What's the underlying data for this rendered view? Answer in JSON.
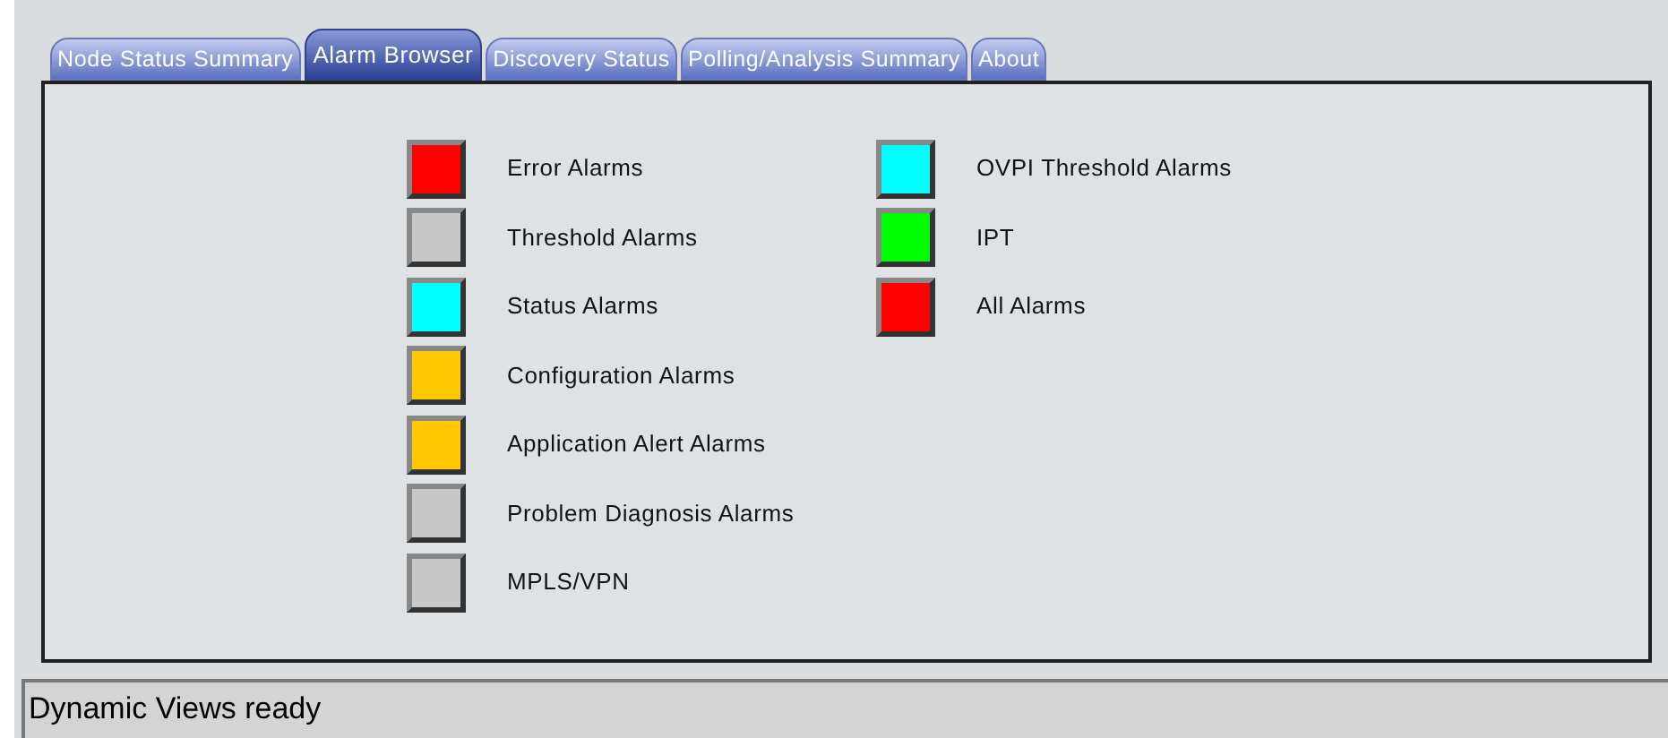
{
  "tabs": [
    {
      "label": "Node Status Summary",
      "selected": false
    },
    {
      "label": "Alarm Browser",
      "selected": true
    },
    {
      "label": "Discovery Status",
      "selected": false
    },
    {
      "label": "Polling/Analysis Summary",
      "selected": false
    },
    {
      "label": "About",
      "selected": false
    }
  ],
  "alarm_columns": [
    [
      {
        "label": "Error Alarms",
        "color": "#ff0000"
      },
      {
        "label": "Threshold Alarms",
        "color": "#c8c8c8"
      },
      {
        "label": "Status Alarms",
        "color": "#00ffff"
      },
      {
        "label": "Configuration Alarms",
        "color": "#ffc800"
      },
      {
        "label": "Application Alert Alarms",
        "color": "#ffc800"
      },
      {
        "label": "Problem Diagnosis Alarms",
        "color": "#c8c8c8"
      },
      {
        "label": "MPLS/VPN",
        "color": "#c8c8c8"
      }
    ],
    [
      {
        "label": "OVPI Threshold Alarms",
        "color": "#00ffff"
      },
      {
        "label": "IPT",
        "color": "#00ff00"
      },
      {
        "label": "All Alarms",
        "color": "#ff0000"
      }
    ]
  ],
  "status_bar": "Dynamic Views ready"
}
